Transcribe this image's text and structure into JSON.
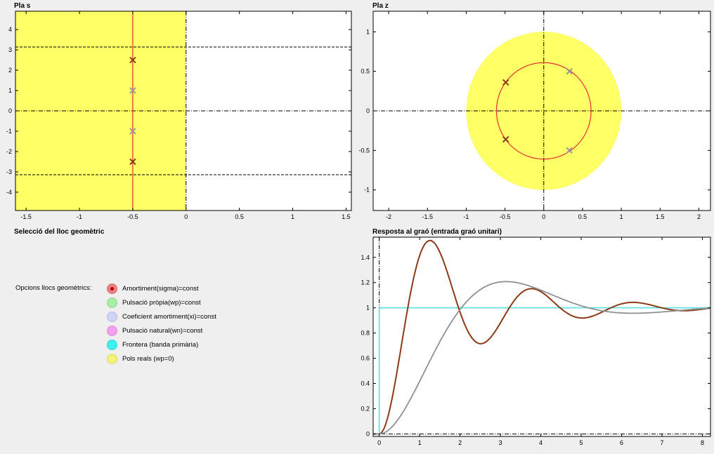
{
  "titles": {
    "s_plane": "Pla s",
    "z_plane": "Pla z",
    "selection": "Selecció del lloc geomètric",
    "step": "Resposta al graó (entrada graó unitari)"
  },
  "options": {
    "label": "Opcions llocs geomètrics:",
    "items": [
      {
        "label": "Amortiment(sigma)=const",
        "color": "#f08080",
        "selected": true
      },
      {
        "label": "Pulsació pròpia(wp)=const",
        "color": "#a8f0a8",
        "selected": false
      },
      {
        "label": "Coeficient amortiment(xi)=const",
        "color": "#d0d4f8",
        "selected": false
      },
      {
        "label": "Pulsació natural(wn)=const",
        "color": "#f4a0f0",
        "selected": false
      },
      {
        "label": "Frontera (banda primària)",
        "color": "#40f0f0",
        "selected": false
      },
      {
        "label": "Pols reals (wp=0)",
        "color": "#f4f478",
        "selected": false
      }
    ]
  },
  "chart_data": [
    {
      "id": "s_plane",
      "type": "scatter",
      "title": "Pla s",
      "xlim": [
        -1.6,
        1.55
      ],
      "ylim": [
        -4.9,
        4.9
      ],
      "xticks": [
        -1.5,
        -1,
        -0.5,
        0,
        0.5,
        1,
        1.5
      ],
      "xtick_labels": [
        "-1.5",
        "-1",
        "-0.5",
        "0",
        "0.5",
        "1",
        "1.5"
      ],
      "yticks": [
        -4,
        -3,
        -2,
        -1,
        0,
        1,
        2,
        3,
        4
      ],
      "ytick_labels": [
        "-4",
        "-3",
        "-2",
        "-1",
        "0",
        "1",
        "2",
        "3",
        "4"
      ],
      "stable_region_color": "#ffff66",
      "locus_sigma": -0.5,
      "band_limits": [
        3.14,
        -3.14
      ],
      "poles_selected": [
        [
          -0.5,
          2.5
        ],
        [
          -0.5,
          -2.5
        ]
      ],
      "poles_reference": [
        [
          -0.5,
          1.0
        ],
        [
          -0.5,
          -1.0
        ]
      ],
      "selected_color": "#8b3a1a",
      "reference_color": "#999999",
      "locus_color": "#e03030"
    },
    {
      "id": "z_plane",
      "type": "scatter",
      "title": "Pla z",
      "xlim": [
        -2.2,
        2.15
      ],
      "ylim": [
        -1.26,
        1.26
      ],
      "xticks": [
        -2,
        -1.5,
        -1,
        -0.5,
        0,
        0.5,
        1,
        1.5,
        2
      ],
      "xtick_labels": [
        "-2",
        "-1.5",
        "-1",
        "-0.5",
        "0",
        "0.5",
        "1",
        "1.5",
        "2"
      ],
      "yticks": [
        -1,
        -0.5,
        0,
        0.5,
        1
      ],
      "ytick_labels": [
        "-1",
        "-0.5",
        "0",
        "0.5",
        "1"
      ],
      "unit_circle_radius": 1.0,
      "unit_circle_fill": "#ffff66",
      "locus_radius": 0.61,
      "poles_selected": [
        [
          -0.49,
          0.36
        ],
        [
          -0.49,
          -0.36
        ]
      ],
      "poles_reference": [
        [
          0.33,
          0.5
        ],
        [
          0.33,
          -0.5
        ]
      ],
      "selected_color": "#8b3a1a",
      "reference_color": "#999999",
      "locus_color": "#e03030"
    },
    {
      "id": "step",
      "type": "line",
      "title": "Resposta al graó (entrada graó unitari)",
      "xlim": [
        -0.15,
        8.2
      ],
      "ylim": [
        -0.02,
        1.56
      ],
      "xticks": [
        0,
        1,
        2,
        3,
        4,
        5,
        6,
        7,
        8
      ],
      "xtick_labels": [
        "0",
        "1",
        "2",
        "3",
        "4",
        "5",
        "6",
        "7",
        "8"
      ],
      "yticks": [
        0,
        0.2,
        0.4,
        0.6,
        0.8,
        1,
        1.2,
        1.4
      ],
      "ytick_labels": [
        "0",
        "0.2",
        "0.4",
        "0.6",
        "0.8",
        "1",
        "1.2",
        "1.4"
      ],
      "series": [
        {
          "color": "#8b3a1a",
          "sigma": 0.5,
          "wd": 2.5
        },
        {
          "color": "#909090",
          "sigma": 0.5,
          "wd": 1.0
        },
        {
          "color": "#66e0e0",
          "step_input": true
        }
      ]
    }
  ]
}
